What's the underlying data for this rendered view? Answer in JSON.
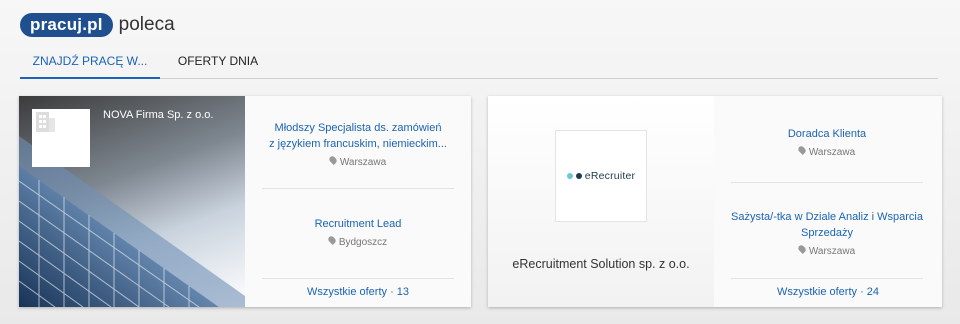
{
  "header": {
    "logo": "pracuj.pl",
    "tagline": "poleca"
  },
  "tabs": [
    {
      "label": "ZNAJDŹ PRACĘ W...",
      "active": true
    },
    {
      "label": "OFERTY DNIA",
      "active": false
    }
  ],
  "cards": [
    {
      "company": "NOVA Firma Sp. z o.o.",
      "offers": [
        {
          "title_line1": "Młodszy Specjalista ds. zamówień",
          "title_line2": "z językiem francuskim, niemieckim...",
          "location": "Warszawa"
        },
        {
          "title_line1": "Recruitment Lead",
          "title_line2": "",
          "location": "Bydgoszcz"
        }
      ],
      "all_offers": "Wszystkie oferty · 13"
    },
    {
      "company": "eRecruitment Solution sp. z o.o.",
      "logo_text": "eRecruiter",
      "offers": [
        {
          "title_line1": "Doradca Klienta",
          "title_line2": "",
          "location": "Warszawa"
        },
        {
          "title_line1": "Sażysta/-tka w Dziale Analiz i Wsparcia",
          "title_line2": "Sprzedaży",
          "location": "Warszawa"
        }
      ],
      "all_offers": "Wszystkie oferty · 24"
    }
  ],
  "colors": {
    "brand": "#1f4f8f",
    "link": "#1b63b4",
    "erec_dot1": "#69c7d8",
    "erec_dot2": "#1d3b4c"
  }
}
